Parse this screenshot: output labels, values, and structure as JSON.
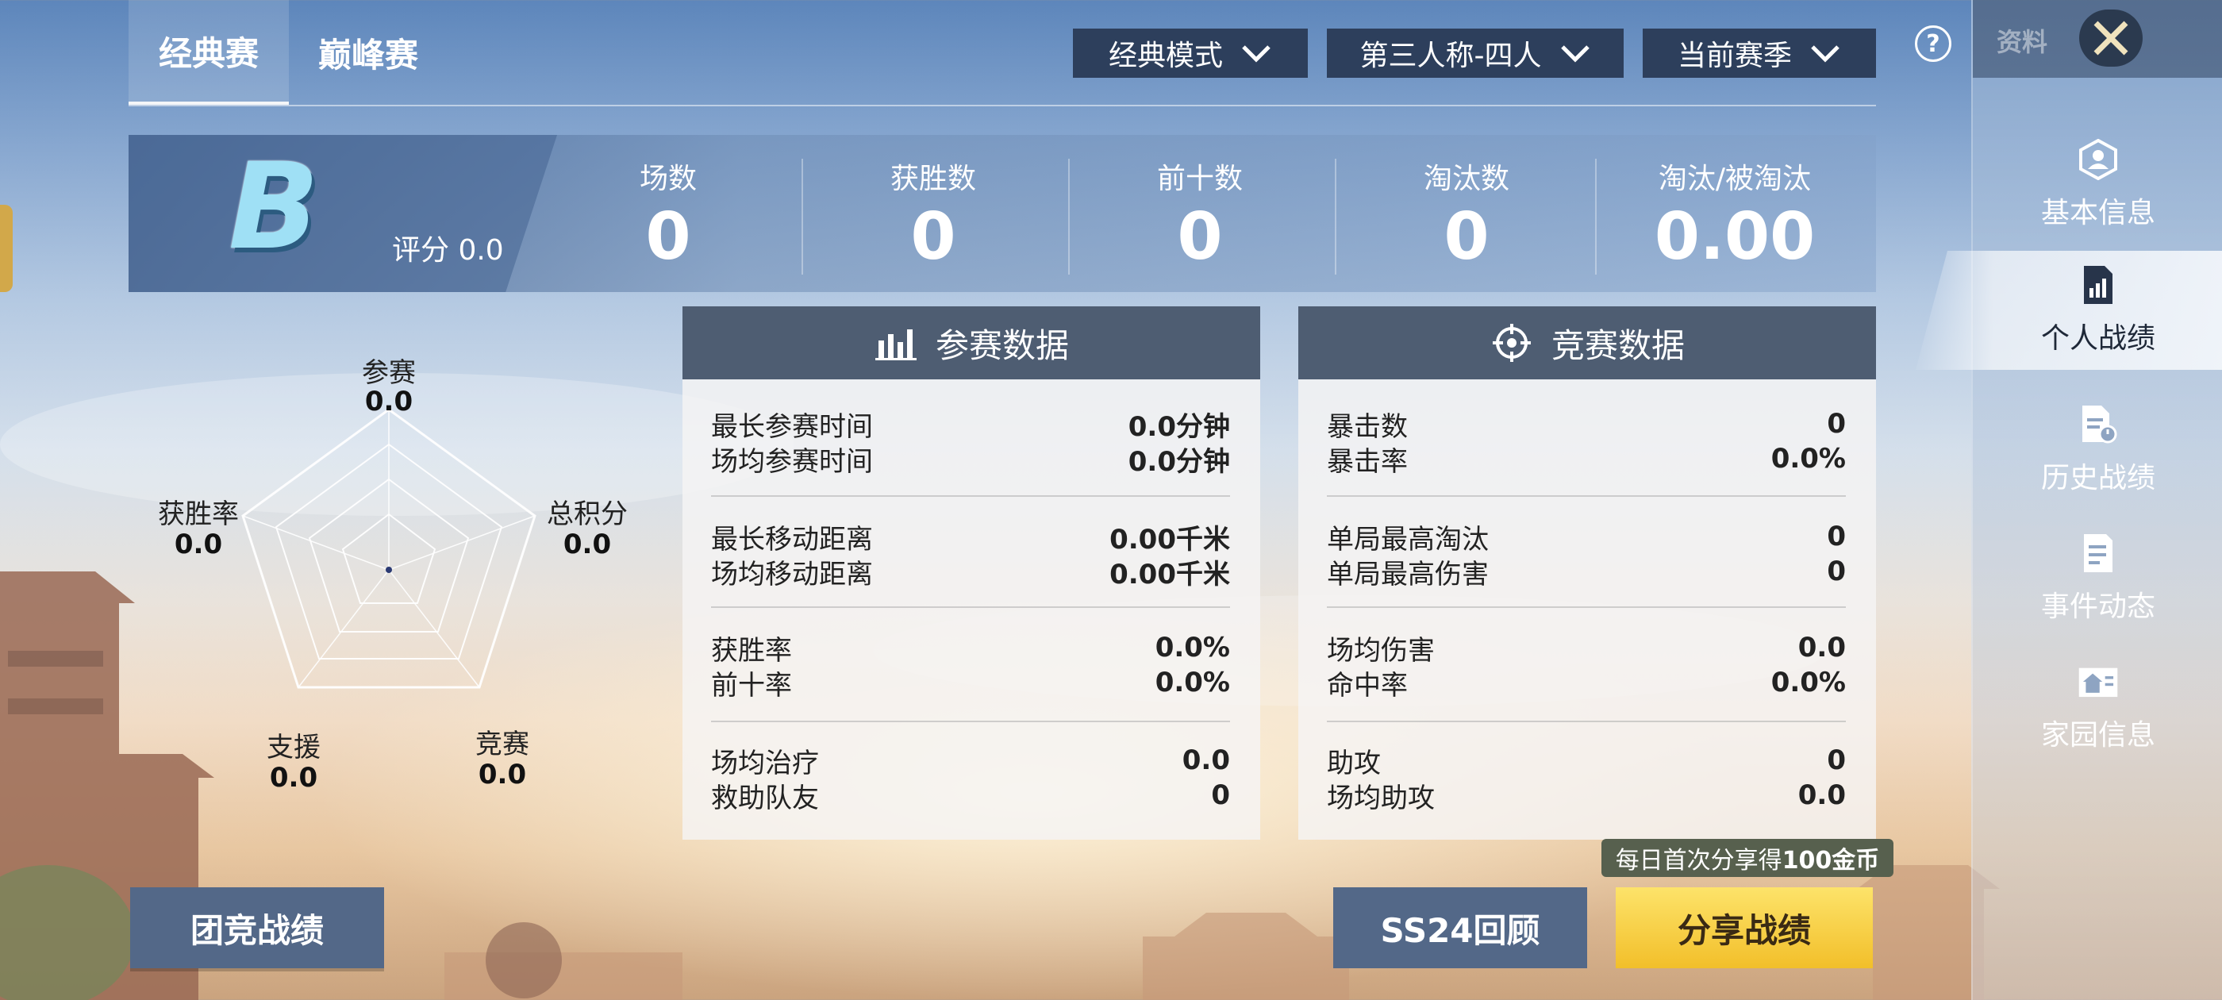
{
  "tabs": [
    {
      "label": "经典赛",
      "active": true
    },
    {
      "label": "巅峰赛",
      "active": false
    }
  ],
  "filters": [
    {
      "label": "经典模式"
    },
    {
      "label": "第三人称-四人"
    },
    {
      "label": "当前赛季"
    }
  ],
  "help_icon": "question-circle-icon",
  "sidebar": {
    "title": "资料",
    "close_icon": "close-icon",
    "items": [
      {
        "label": "基本信息",
        "icon": "profile-icon",
        "active": false
      },
      {
        "label": "个人战绩",
        "icon": "bar-chart-doc-icon",
        "active": true
      },
      {
        "label": "历史战绩",
        "icon": "history-doc-icon",
        "active": false
      },
      {
        "label": "事件动态",
        "icon": "event-doc-icon",
        "active": false
      },
      {
        "label": "家园信息",
        "icon": "home-icon",
        "active": false
      }
    ]
  },
  "summary": {
    "grade": "B",
    "score_label": "评分 0.0",
    "stats": [
      {
        "label": "场数",
        "value": "0"
      },
      {
        "label": "获胜数",
        "value": "0"
      },
      {
        "label": "前十数",
        "value": "0"
      },
      {
        "label": "淘汰数",
        "value": "0"
      },
      {
        "label": "淘汰/被淘汰",
        "value": "0.00"
      }
    ]
  },
  "radar": {
    "axes": [
      {
        "label": "参赛",
        "value": "0.0"
      },
      {
        "label": "总积分",
        "value": "0.0"
      },
      {
        "label": "竞赛",
        "value": "0.0"
      },
      {
        "label": "支援",
        "value": "0.0"
      },
      {
        "label": "获胜率",
        "value": "0.0"
      }
    ]
  },
  "participation_panel": {
    "title": "参赛数据",
    "icon": "bar-chart-icon",
    "groups": [
      [
        {
          "label": "最长参赛时间",
          "value": "0.0分钟"
        },
        {
          "label": "场均参赛时间",
          "value": "0.0分钟"
        }
      ],
      [
        {
          "label": "最长移动距离",
          "value": "0.00千米"
        },
        {
          "label": "场均移动距离",
          "value": "0.00千米"
        }
      ],
      [
        {
          "label": "获胜率",
          "value": "0.0%"
        },
        {
          "label": "前十率",
          "value": "0.0%"
        }
      ],
      [
        {
          "label": "场均治疗",
          "value": "0.0"
        },
        {
          "label": "救助队友",
          "value": "0"
        }
      ]
    ]
  },
  "combat_panel": {
    "title": "竞赛数据",
    "icon": "crosshair-icon",
    "groups": [
      [
        {
          "label": "暴击数",
          "value": "0"
        },
        {
          "label": "暴击率",
          "value": "0.0%"
        }
      ],
      [
        {
          "label": "单局最高淘汰",
          "value": "0"
        },
        {
          "label": "单局最高伤害",
          "value": "0"
        }
      ],
      [
        {
          "label": "场均伤害",
          "value": "0.0"
        },
        {
          "label": "命中率",
          "value": "0.0%"
        }
      ],
      [
        {
          "label": "助攻",
          "value": "0"
        },
        {
          "label": "场均助攻",
          "value": "0.0"
        }
      ]
    ]
  },
  "buttons": {
    "team": "团竞战绩",
    "review": "SS24回顾",
    "share": "分享战绩",
    "share_tip_prefix": "每日首次分享得",
    "share_tip_amount": "100金币"
  },
  "colors": {
    "panel_header": "#4e5d72",
    "button_blue": "#536888",
    "button_gold": "#f2bf2a",
    "dropdown": "#2d3f5c"
  }
}
